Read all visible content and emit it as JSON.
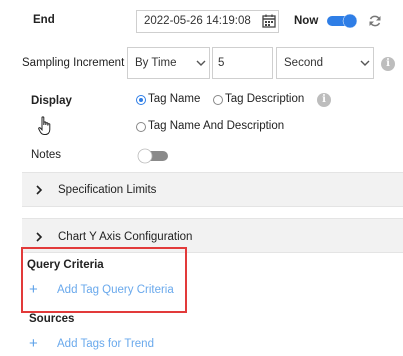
{
  "end": {
    "label": "End",
    "date_value": "2022-05-26 14:19:08",
    "calendar_icon": "calendar-icon",
    "now_label": "Now",
    "now_enabled": true,
    "refresh_icon": "refresh-icon"
  },
  "sampling": {
    "label": "Sampling Increment",
    "mode_value": "By Time",
    "count_value": "5",
    "unit_value": "Second",
    "info_icon": "info-icon"
  },
  "display": {
    "label": "Display",
    "options": [
      "Tag Name",
      "Tag Description",
      "Tag Name And Description"
    ],
    "selected": "Tag Name",
    "info_icon": "info-icon"
  },
  "notes": {
    "label": "Notes",
    "enabled": false
  },
  "panels": {
    "specification_limits": "Specification Limits",
    "chart_y_axis": "Chart Y Axis Configuration"
  },
  "query_criteria": {
    "title": "Query Criteria",
    "add_label": "Add Tag Query Criteria",
    "add_icon": "plus-icon"
  },
  "sources": {
    "title": "Sources",
    "add_label": "Add Tags for Trend",
    "add_icon": "plus-icon"
  },
  "colors": {
    "accent": "#2f7ee6",
    "link": "#6aa9ec",
    "highlight_border": "#e23a3a",
    "panel_bg": "#f2f2f2"
  }
}
